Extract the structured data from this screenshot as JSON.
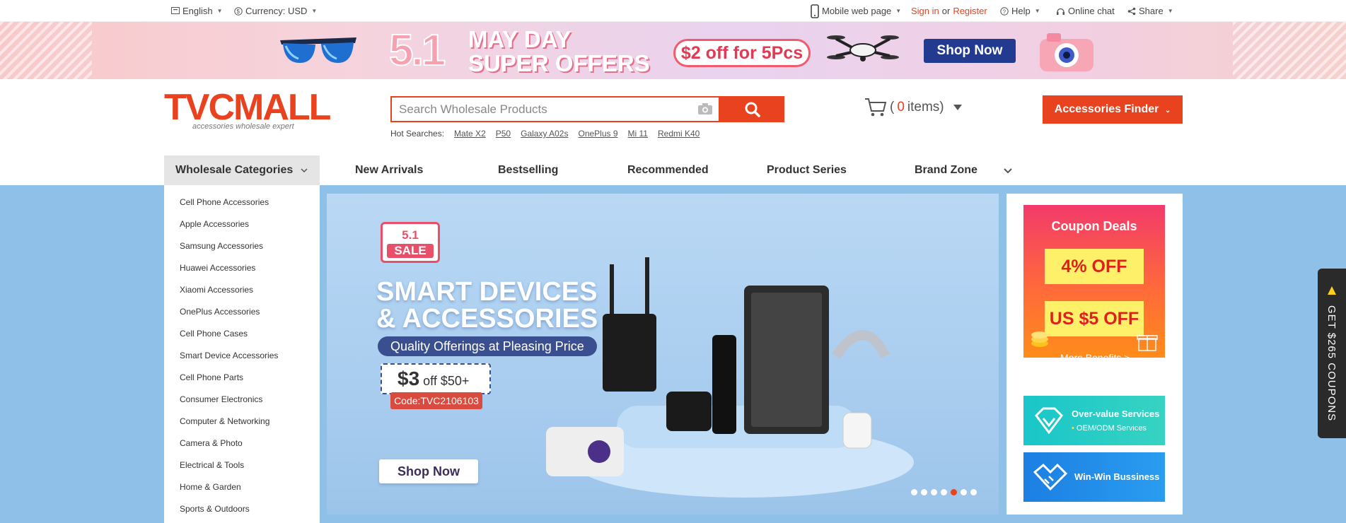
{
  "topbar": {
    "language": "English",
    "currency": "Currency: USD",
    "mobile": "Mobile web page",
    "sign_in": "Sign in",
    "or": "or",
    "register": "Register",
    "help": "Help",
    "online_chat": "Online chat",
    "share": "Share"
  },
  "promo": {
    "number": "5.1",
    "title_line1": "MAY DAY",
    "title_line2": "SUPER OFFERS",
    "pill": "$2 off for 5Pcs",
    "shop": "Shop Now"
  },
  "header": {
    "logo_text": "TVCMALL",
    "logo_tagline": "accessories wholesale expert",
    "search_placeholder": "Search Wholesale Products",
    "hot_label": "Hot Searches:",
    "hot_searches": [
      "Mate X2",
      "P50",
      "Galaxy A02s",
      "OnePlus 9",
      "Mi 11",
      "Redmi K40"
    ],
    "cart_open": "(",
    "cart_count": "0",
    "cart_label": " items)",
    "finder": "Accessories Finder"
  },
  "nav": {
    "categories_label": "Wholesale Categories",
    "links": [
      "New Arrivals",
      "Bestselling",
      "Recommended",
      "Product Series",
      "Brand Zone"
    ]
  },
  "categories": [
    "Cell Phone Accessories",
    "Apple Accessories",
    "Samsung Accessories",
    "Huawei Accessories",
    "Xiaomi Accessories",
    "OnePlus Accessories",
    "Cell Phone Cases",
    "Smart Device Accessories",
    "Cell Phone Parts",
    "Consumer Electronics",
    "Computer & Networking",
    "Camera & Photo",
    "Electrical & Tools",
    "Home & Garden",
    "Sports & Outdoors"
  ],
  "hero": {
    "sale_top": "5.1",
    "sale_bottom": "SALE",
    "title_line1": "SMART DEVICES",
    "title_line2": "& ACCESSORIES",
    "subtitle": "Quality Offerings at Pleasing Price",
    "coupon_amount": "$3",
    "coupon_rest": " off $50+",
    "code": "Code:TVC2106103",
    "shop": "Shop Now",
    "slides": 7,
    "active_slide": 5
  },
  "side": {
    "coupon_title": "Coupon Deals",
    "ticket1": "4% OFF",
    "ticket2": "US $5 OFF",
    "more": "More Benefits >",
    "service1_title": "Over-value Services",
    "service1_sub": "OEM/ODM Services",
    "service2_title": "Win-Win Bussiness"
  },
  "float_coupon": "GET $265 COUPONS",
  "colors": {
    "brand": "#e8421e",
    "hero_bg": "#8fc0e8",
    "navy": "#223a8f"
  }
}
